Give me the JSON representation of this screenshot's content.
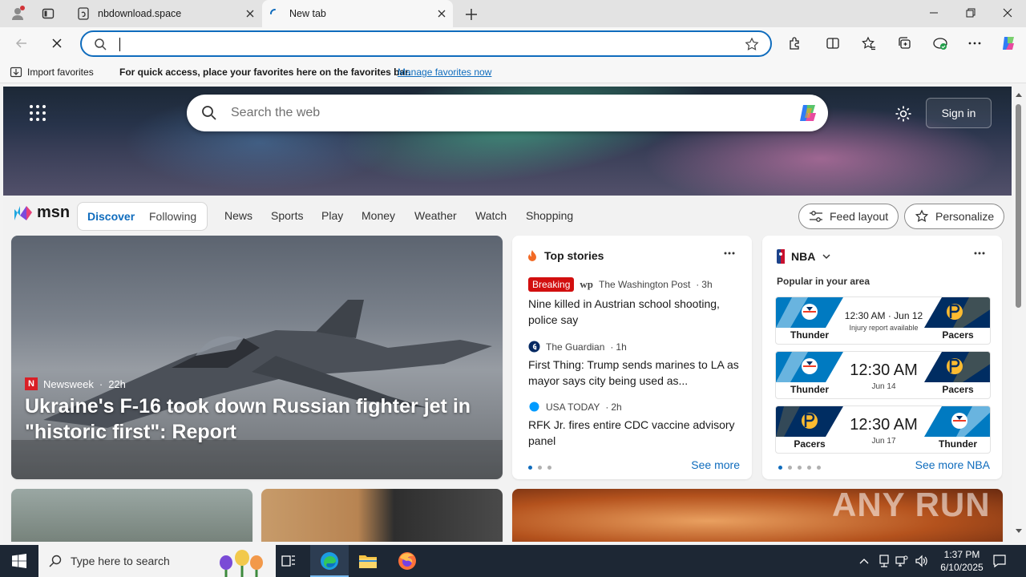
{
  "browser": {
    "tabs": [
      {
        "title": "nbdownload.space"
      },
      {
        "title": "New tab"
      }
    ],
    "address_value": "",
    "favorites_bar": {
      "import_label": "Import favorites",
      "hint": "For quick access, place your favorites here on the favorites bar.",
      "manage_link": "Manage favorites now"
    }
  },
  "msn": {
    "search_placeholder": "Search the web",
    "sign_in": "Sign in",
    "logo": "msn",
    "tabs": [
      "Discover",
      "Following"
    ],
    "nav": [
      "News",
      "Sports",
      "Play",
      "Money",
      "Weather",
      "Watch",
      "Shopping"
    ],
    "feed_layout": "Feed layout",
    "personalize": "Personalize",
    "main_story": {
      "source": "Newsweek",
      "age": "22h",
      "title": "Ukraine's F-16 took down Russian fighter jet in \"historic first\": Report"
    },
    "top_stories": {
      "header": "Top stories",
      "items": [
        {
          "badge": "Breaking",
          "source": "The Washington Post",
          "age": "3h",
          "title": "Nine killed in Austrian school shooting, police say"
        },
        {
          "source": "The Guardian",
          "age": "1h",
          "title": "First Thing: Trump sends marines to LA as mayor says city being used as..."
        },
        {
          "source": "USA TODAY",
          "age": "2h",
          "title": "RFK Jr. fires entire CDC vaccine advisory panel"
        }
      ],
      "see_more": "See more"
    },
    "nba": {
      "header": "NBA",
      "subheader": "Popular in your area",
      "games": [
        {
          "left": "Thunder",
          "right": "Pacers",
          "time": "12:30 AM · Jun 12",
          "note": "Injury report available"
        },
        {
          "left": "Thunder",
          "right": "Pacers",
          "time": "12:30 AM",
          "note": "Jun 14"
        },
        {
          "left": "Pacers",
          "right": "Thunder",
          "time": "12:30 AM",
          "note": "Jun 17"
        }
      ],
      "see_more": "See more NBA"
    }
  },
  "taskbar": {
    "search_placeholder": "Type here to search",
    "time": "1:37 PM",
    "date": "6/10/2025"
  },
  "watermark": "ANY RUN",
  "colors": {
    "accent": "#0f6cbd",
    "breaking": "#d20f0f",
    "taskbar": "#1d2734",
    "thunder": "#007ac1",
    "pacers": "#002d62"
  }
}
